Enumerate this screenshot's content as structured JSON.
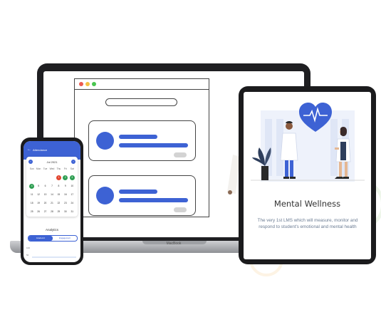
{
  "colors": {
    "accent_blue": "#3d62d4",
    "calendar_green": "#2e9e52",
    "calendar_red": "#e2452f",
    "device_black": "#1b1b1d"
  },
  "laptop": {
    "brand_label": "MacBook",
    "browser_dots": [
      "#ec5a4f",
      "#f4c041",
      "#48c54f"
    ]
  },
  "phone": {
    "header_title": "Attendance",
    "back_icon": "arrow-left-icon",
    "month_label": "Jul 2021",
    "prev_icon": "chevron-left-icon",
    "next_icon": "chevron-right-icon",
    "weekdays": [
      "Sun",
      "Mon",
      "Tue",
      "Wed",
      "Thu",
      "Fri",
      "Sat"
    ],
    "weeks": [
      [
        "",
        "",
        "",
        "",
        "1",
        "2",
        "3"
      ],
      [
        "4",
        "5",
        "6",
        "7",
        "8",
        "9",
        "10"
      ],
      [
        "11",
        "12",
        "13",
        "14",
        "15",
        "16",
        "17"
      ],
      [
        "18",
        "19",
        "20",
        "21",
        "22",
        "23",
        "24"
      ],
      [
        "25",
        "26",
        "27",
        "28",
        "29",
        "30",
        "31"
      ]
    ],
    "green_days": [
      "2",
      "3",
      "4"
    ],
    "red_days": [
      "1"
    ],
    "analytics_title": "Analytics",
    "tab_active": "Academic",
    "tab_inactive": "Engagement",
    "axis_labels": [
      "100",
      "50"
    ]
  },
  "tablet": {
    "title": "Mental Wellness",
    "description": "The very 1st LMS which will measure, monitor and respond to student's emotional and mental health",
    "hero_icon": "heart-pulse-icon"
  }
}
